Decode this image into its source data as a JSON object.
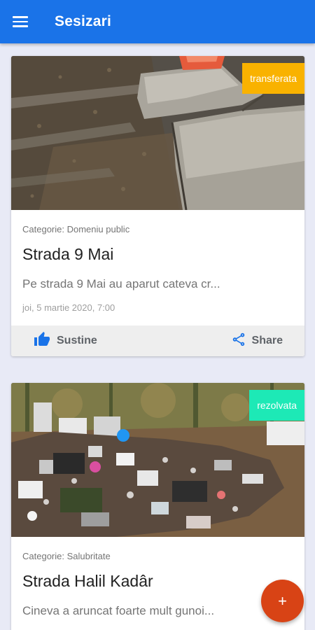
{
  "app": {
    "title": "Sesizari"
  },
  "colors": {
    "primary": "#1a73e8",
    "accent_fab": "#d84315",
    "badge_transferred": "#f9b200",
    "badge_resolved": "#1de9b6"
  },
  "cards": [
    {
      "status": "transferata",
      "category": "Categorie: Domeniu public",
      "title": "Strada 9 Mai",
      "description": "Pe strada 9 Mai au aparut cateva cr...",
      "date": "joi, 5 martie 2020, 7:00",
      "support_label": "Sustine",
      "share_label": "Share"
    },
    {
      "status": "rezolvata",
      "category": "Categorie: Salubritate",
      "title": "Strada Halil Kadâr",
      "description": "Cineva a aruncat foarte mult gunoi..."
    }
  ],
  "fab": {
    "icon": "plus-icon",
    "symbol": "+"
  },
  "icons": [
    "menu-icon",
    "thumb-up-icon",
    "share-icon",
    "plus-icon"
  ]
}
